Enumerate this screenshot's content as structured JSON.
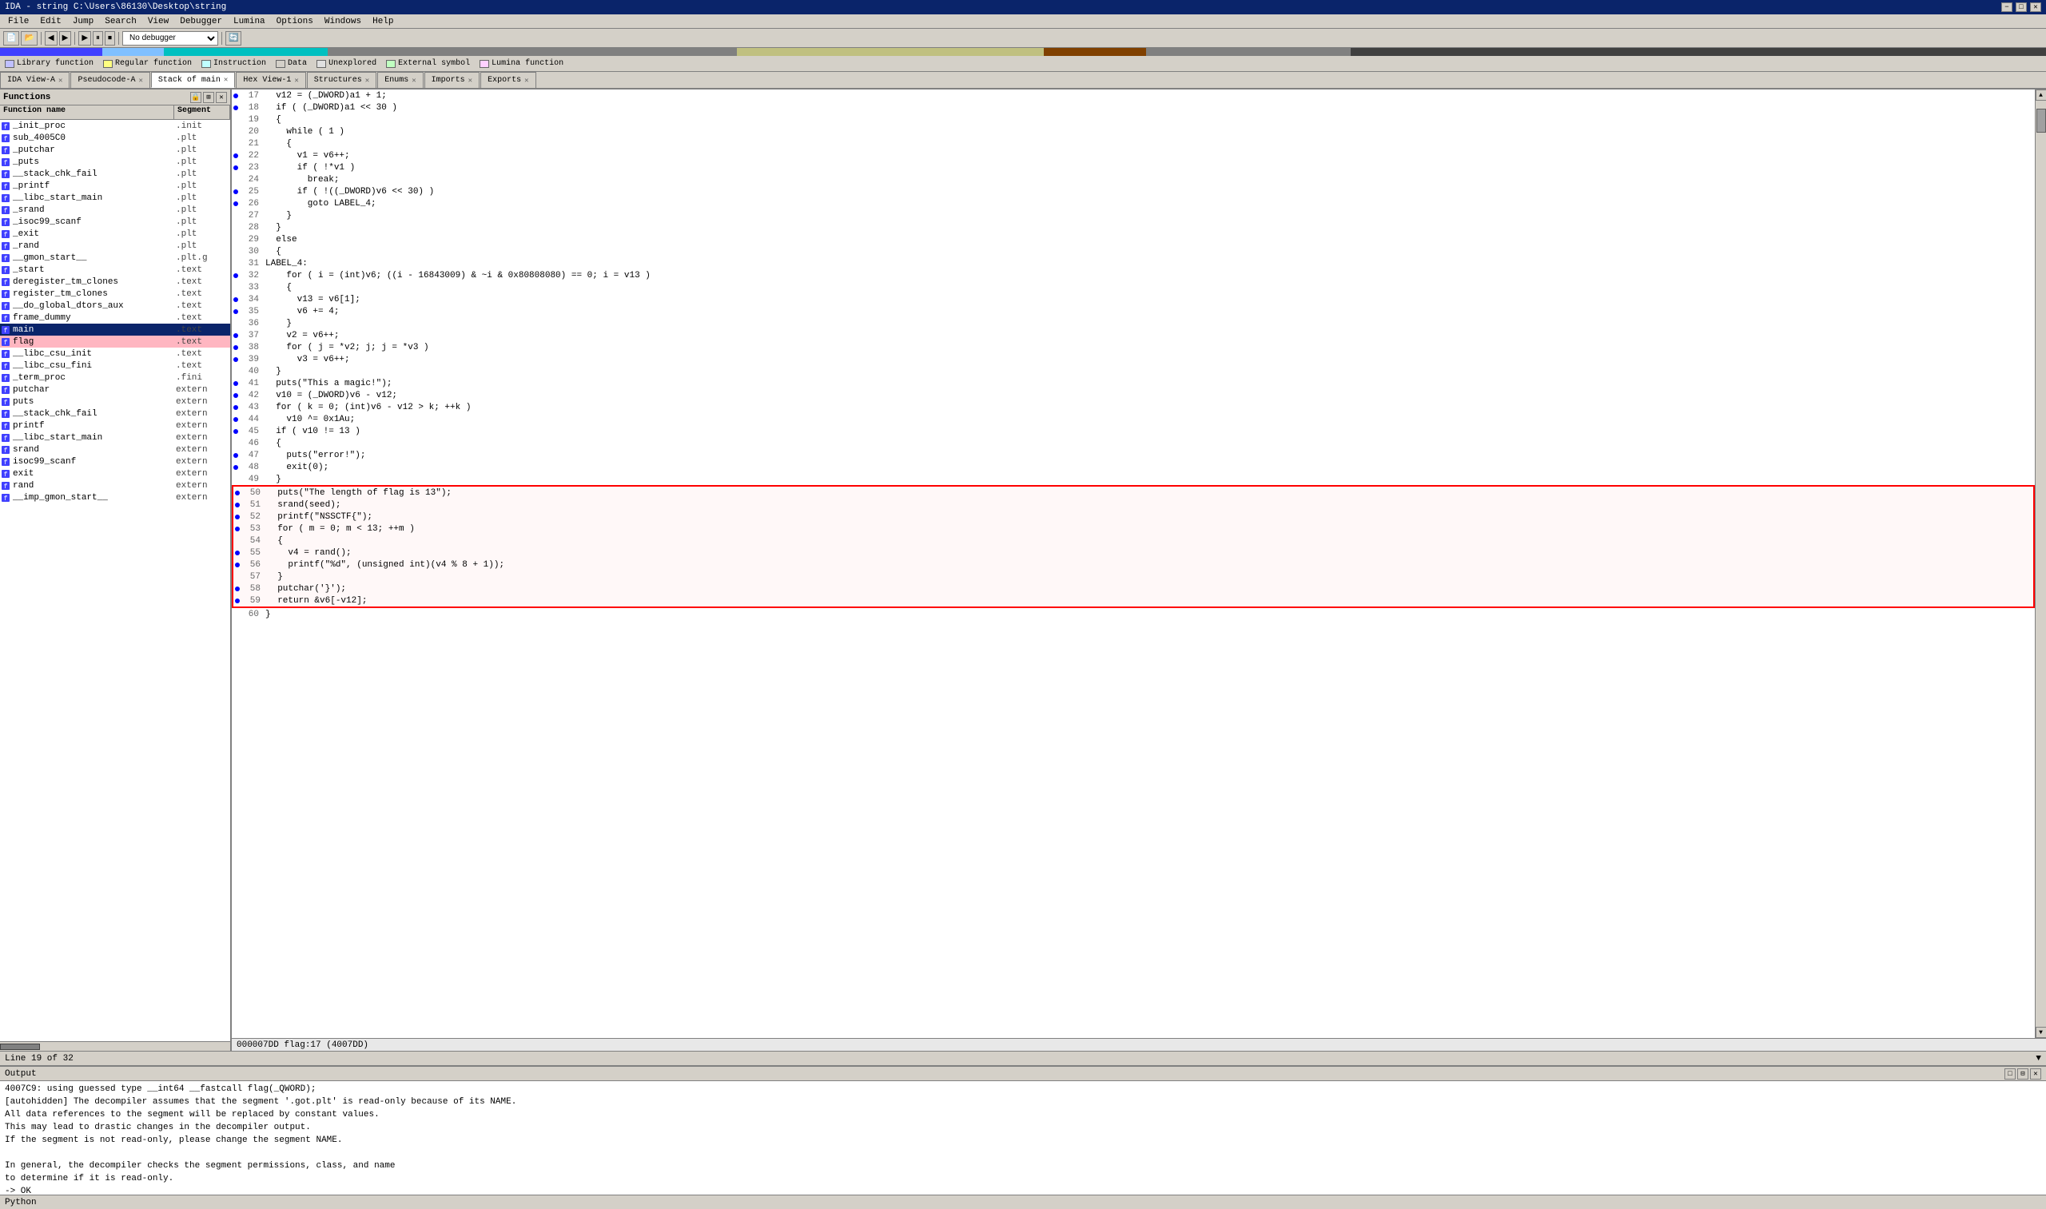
{
  "titleBar": {
    "title": "IDA - string C:\\Users\\86130\\Desktop\\string",
    "minimize": "−",
    "maximize": "□",
    "close": "✕"
  },
  "menuBar": {
    "items": [
      "File",
      "Edit",
      "Jump",
      "Search",
      "View",
      "Debugger",
      "Lumina",
      "Options",
      "Windows",
      "Help"
    ]
  },
  "toolbar": {
    "debuggerLabel": "No debugger"
  },
  "legend": {
    "items": [
      {
        "label": "Library function",
        "color": "#c0c0ff"
      },
      {
        "label": "Regular function",
        "color": "#ffff80"
      },
      {
        "label": "Instruction",
        "color": "#c0ffff"
      },
      {
        "label": "Data",
        "color": "#d4d0c8"
      },
      {
        "label": "Unexplored",
        "color": "#e0e0e0"
      },
      {
        "label": "External symbol",
        "color": "#c0ffc0"
      },
      {
        "label": "Lumina function",
        "color": "#ffd0ff"
      }
    ]
  },
  "tabs": [
    {
      "id": "ida-view",
      "label": "IDA View-A",
      "active": false,
      "closeable": true
    },
    {
      "id": "pseudocode",
      "label": "Pseudocode-A",
      "active": false,
      "closeable": true
    },
    {
      "id": "stack-main",
      "label": "Stack of main",
      "active": true,
      "closeable": true
    },
    {
      "id": "hex-view",
      "label": "Hex View-1",
      "active": false,
      "closeable": true
    },
    {
      "id": "structures",
      "label": "Structures",
      "active": false,
      "closeable": true
    },
    {
      "id": "enums",
      "label": "Enums",
      "active": false,
      "closeable": true
    },
    {
      "id": "imports",
      "label": "Imports",
      "active": false,
      "closeable": true
    },
    {
      "id": "exports",
      "label": "Exports",
      "active": false,
      "closeable": true
    }
  ],
  "functionsPanel": {
    "title": "Functions",
    "columns": [
      "Function name",
      "Segment"
    ],
    "functions": [
      {
        "name": "_init_proc",
        "segment": ".init",
        "icon": "f",
        "highlighted": false
      },
      {
        "name": "sub_4005C0",
        "segment": ".plt",
        "icon": "f",
        "highlighted": false
      },
      {
        "name": "_putchar",
        "segment": ".plt",
        "icon": "f",
        "highlighted": false
      },
      {
        "name": "_puts",
        "segment": ".plt",
        "icon": "f",
        "highlighted": false
      },
      {
        "name": "__stack_chk_fail",
        "segment": ".plt",
        "icon": "f",
        "highlighted": false
      },
      {
        "name": "_printf",
        "segment": ".plt",
        "icon": "f",
        "highlighted": false
      },
      {
        "name": "__libc_start_main",
        "segment": ".plt",
        "icon": "f",
        "highlighted": false
      },
      {
        "name": "_srand",
        "segment": ".plt",
        "icon": "f",
        "highlighted": false
      },
      {
        "name": "_isoc99_scanf",
        "segment": ".plt",
        "icon": "f",
        "highlighted": false
      },
      {
        "name": "_exit",
        "segment": ".plt",
        "icon": "f",
        "highlighted": false
      },
      {
        "name": "_rand",
        "segment": ".plt",
        "icon": "f",
        "highlighted": false
      },
      {
        "name": "__gmon_start__",
        "segment": ".plt.g",
        "icon": "f",
        "highlighted": false
      },
      {
        "name": "_start",
        "segment": ".text",
        "icon": "f",
        "highlighted": false
      },
      {
        "name": "deregister_tm_clones",
        "segment": ".text",
        "icon": "f",
        "highlighted": false
      },
      {
        "name": "register_tm_clones",
        "segment": ".text",
        "icon": "f",
        "highlighted": false
      },
      {
        "name": "__do_global_dtors_aux",
        "segment": ".text",
        "icon": "f",
        "highlighted": false
      },
      {
        "name": "frame_dummy",
        "segment": ".text",
        "icon": "f",
        "highlighted": false
      },
      {
        "name": "main",
        "segment": ".text",
        "icon": "f",
        "highlighted": false,
        "selected": true
      },
      {
        "name": "flag",
        "segment": ".text",
        "icon": "f",
        "highlighted": true
      },
      {
        "name": "__libc_csu_init",
        "segment": ".text",
        "icon": "f",
        "highlighted": false
      },
      {
        "name": "__libc_csu_fini",
        "segment": ".text",
        "icon": "f",
        "highlighted": false
      },
      {
        "name": "_term_proc",
        "segment": ".fini",
        "icon": "f",
        "highlighted": false
      },
      {
        "name": "putchar",
        "segment": "extern",
        "icon": "f",
        "highlighted": false
      },
      {
        "name": "puts",
        "segment": "extern",
        "icon": "f",
        "highlighted": false
      },
      {
        "name": "__stack_chk_fail",
        "segment": "extern",
        "icon": "f",
        "highlighted": false
      },
      {
        "name": "printf",
        "segment": "extern",
        "icon": "f",
        "highlighted": false
      },
      {
        "name": "__libc_start_main",
        "segment": "extern",
        "icon": "f",
        "highlighted": false
      },
      {
        "name": "srand",
        "segment": "extern",
        "icon": "f",
        "highlighted": false
      },
      {
        "name": "isoc99_scanf",
        "segment": "extern",
        "icon": "f",
        "highlighted": false
      },
      {
        "name": "exit",
        "segment": "extern",
        "icon": "f",
        "highlighted": false
      },
      {
        "name": "rand",
        "segment": "extern",
        "icon": "f",
        "highlighted": false
      },
      {
        "name": "__imp_gmon_start__",
        "segment": "extern",
        "icon": "f",
        "highlighted": false
      }
    ]
  },
  "codeLines": [
    {
      "num": 17,
      "dot": true,
      "code": "  v12 = (_DWORD)a1 + 1;"
    },
    {
      "num": 18,
      "dot": true,
      "code": "  if ( (_DWORD)a1 << 30 )"
    },
    {
      "num": 19,
      "dot": false,
      "code": "  {"
    },
    {
      "num": 20,
      "dot": false,
      "code": "    while ( 1 )"
    },
    {
      "num": 21,
      "dot": false,
      "code": "    {"
    },
    {
      "num": 22,
      "dot": true,
      "code": "      v1 = v6++;"
    },
    {
      "num": 23,
      "dot": true,
      "code": "      if ( !*v1 )"
    },
    {
      "num": 24,
      "dot": false,
      "code": "        break;"
    },
    {
      "num": 25,
      "dot": true,
      "code": "      if ( !((_DWORD)v6 << 30) )"
    },
    {
      "num": 26,
      "dot": true,
      "code": "        goto LABEL_4;"
    },
    {
      "num": 27,
      "dot": false,
      "code": "    }"
    },
    {
      "num": 28,
      "dot": false,
      "code": "  }"
    },
    {
      "num": 29,
      "dot": false,
      "code": "  else"
    },
    {
      "num": 30,
      "dot": false,
      "code": "  {"
    },
    {
      "num": 31,
      "dot": false,
      "code": "LABEL_4:"
    },
    {
      "num": 32,
      "dot": true,
      "code": "    for ( i = (int)v6; ((i - 16843009) & ~i & 0x80808080) == 0; i = v13 )"
    },
    {
      "num": 33,
      "dot": false,
      "code": "    {"
    },
    {
      "num": 34,
      "dot": true,
      "code": "      v13 = v6[1];"
    },
    {
      "num": 35,
      "dot": true,
      "code": "      v6 += 4;"
    },
    {
      "num": 36,
      "dot": false,
      "code": "    }"
    },
    {
      "num": 37,
      "dot": true,
      "code": "    v2 = v6++;"
    },
    {
      "num": 38,
      "dot": true,
      "code": "    for ( j = *v2; j; j = *v3 )"
    },
    {
      "num": 39,
      "dot": true,
      "code": "      v3 = v6++;"
    },
    {
      "num": 40,
      "dot": false,
      "code": "  }"
    },
    {
      "num": 41,
      "dot": true,
      "code": "  puts(\"This a magic!\");"
    },
    {
      "num": 42,
      "dot": true,
      "code": "  v10 = (_DWORD)v6 - v12;"
    },
    {
      "num": 43,
      "dot": true,
      "code": "  for ( k = 0; (int)v6 - v12 > k; ++k )"
    },
    {
      "num": 44,
      "dot": true,
      "code": "    v10 ^= 0x1Au;"
    },
    {
      "num": 45,
      "dot": true,
      "code": "  if ( v10 != 13 )"
    },
    {
      "num": 46,
      "dot": false,
      "code": "  {"
    },
    {
      "num": 47,
      "dot": true,
      "code": "    puts(\"error!\");"
    },
    {
      "num": 48,
      "dot": true,
      "code": "    exit(0);"
    },
    {
      "num": 49,
      "dot": false,
      "code": "  }"
    },
    {
      "num": 50,
      "dot": true,
      "code": "  puts(\"The length of flag is 13\");",
      "boxStart": true
    },
    {
      "num": 51,
      "dot": true,
      "code": "  srand(seed);"
    },
    {
      "num": 52,
      "dot": true,
      "code": "  printf(\"NSSCTF{\");"
    },
    {
      "num": 53,
      "dot": true,
      "code": "  for ( m = 0; m < 13; ++m )"
    },
    {
      "num": 54,
      "dot": false,
      "code": "  {"
    },
    {
      "num": 55,
      "dot": true,
      "code": "    v4 = rand();"
    },
    {
      "num": 56,
      "dot": true,
      "code": "    printf(\"%d\", (unsigned int)(v4 % 8 + 1));"
    },
    {
      "num": 57,
      "dot": false,
      "code": "  }"
    },
    {
      "num": 58,
      "dot": true,
      "code": "  putchar('}');"
    },
    {
      "num": 59,
      "dot": true,
      "code": "  return &v6[-v12];",
      "boxEnd": true
    },
    {
      "num": 60,
      "dot": false,
      "code": "}"
    }
  ],
  "statusBar": {
    "lineInfo": "Line 19 of 32",
    "address": "000007DD flag:17 (4007DD)"
  },
  "outputPanel": {
    "title": "Output",
    "lines": [
      "4007C9: using guessed type __int64 __fastcall flag(_QWORD);",
      "[autohidden] The decompiler assumes that the segment '.got.plt' is read-only because of its NAME.",
      "All data references to the segment will be replaced by constant values.",
      "This may lead to drastic changes in the decompiler output.",
      "If the segment is not read-only, please change the segment NAME.",
      "",
      "In general, the decompiler checks the segment permissions, class, and name",
      "to determine if it is read-only.",
      "-> OK"
    ]
  },
  "pythonBar": {
    "label": "Python"
  },
  "segmentBar": [
    {
      "color": "#4040ff",
      "width": "5%"
    },
    {
      "color": "#80c0ff",
      "width": "3%"
    },
    {
      "color": "#00c0c0",
      "width": "8%"
    },
    {
      "color": "#808080",
      "width": "20%"
    },
    {
      "color": "#c0c080",
      "width": "15%"
    },
    {
      "color": "#804000",
      "width": "5%"
    },
    {
      "color": "#808080",
      "width": "10%"
    },
    {
      "color": "#404040",
      "width": "34%"
    }
  ]
}
